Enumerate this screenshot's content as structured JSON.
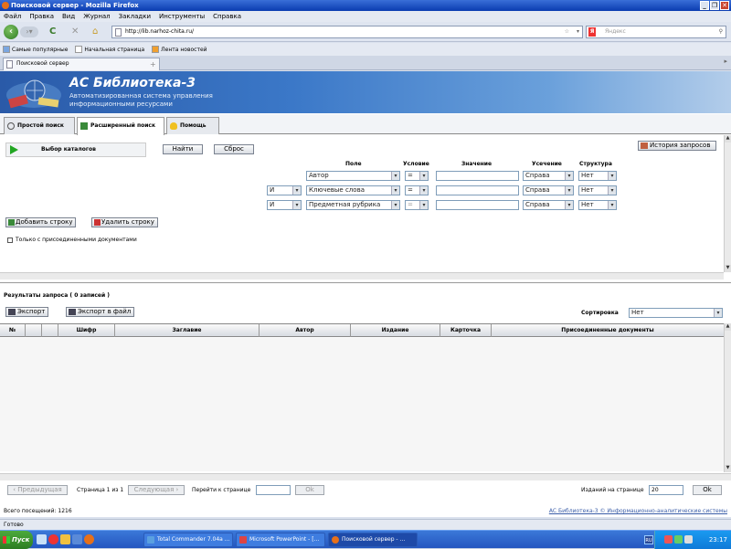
{
  "window": {
    "title": "Поисковой сервер - Mozilla Firefox",
    "controls": [
      "_",
      "❐",
      "✕"
    ]
  },
  "menu": [
    "Файл",
    "Правка",
    "Вид",
    "Журнал",
    "Закладки",
    "Инструменты",
    "Справка"
  ],
  "nav": {
    "url": "http://lib.narhoz-chita.ru/",
    "search_placeholder": "Яндекс",
    "search_engine_letter": "Я"
  },
  "bookmarks": [
    "Самые популярные",
    "Начальная страница",
    "Лента новостей"
  ],
  "browser_tab": {
    "label": "Поисковой сервер"
  },
  "banner": {
    "title": "АС Библиотека-3",
    "subtitle_line1": "Автоматизированная система управления",
    "subtitle_line2": "информационными ресурсами"
  },
  "search_tabs": [
    {
      "label": "Простой поиск"
    },
    {
      "label": "Расширенный поиск"
    },
    {
      "label": "Помощь"
    }
  ],
  "search_form": {
    "catalog_label": "Выбор каталогов",
    "find_button": "Найти",
    "reset_button": "Сброс",
    "history_button": "История запросов",
    "columns": {
      "field": "Поле",
      "condition": "Условие",
      "value": "Значение",
      "truncation": "Усечение",
      "structure": "Структура"
    },
    "rows": [
      {
        "logic": "",
        "field": "Автор",
        "condition": "=",
        "truncation": "Справа",
        "structure": "Нет"
      },
      {
        "logic": "И",
        "field": "Ключевые слова",
        "condition": "=",
        "truncation": "Справа",
        "structure": "Нет"
      },
      {
        "logic": "И",
        "field": "Предметная рубрика",
        "condition": "=",
        "truncation": "Справа",
        "structure": "Нет"
      }
    ],
    "add_row_button": "Добавить строку",
    "delete_row_button": "Удалить строку",
    "attached_checkbox_label": "Только с присоединенными документами"
  },
  "results": {
    "title": "Результаты запроса ( 0 записей )",
    "export_button": "Экспорт",
    "export_file_button": "Экспорт в файл",
    "sort_label": "Сортировка",
    "sort_value": "Нет",
    "columns": [
      "№",
      "",
      "",
      "Шифр",
      "Заглавие",
      "Автор",
      "Издание",
      "Карточка",
      "Присоединенные документы"
    ]
  },
  "pager": {
    "prev": "‹ Предыдущая",
    "page_info": "Страница 1 из 1",
    "next": "Следующая ›",
    "goto_label": "Перейти к странице",
    "goto_button": "Ok",
    "per_page_label": "Изданий на странице",
    "per_page_value": "20",
    "per_page_button": "Ok"
  },
  "footer": {
    "visits": "Всего посещений: 1216",
    "copyright": "АС Библиотека-3 © Информационно-аналитические системы"
  },
  "status": "Готово",
  "taskbar": {
    "start": "Пуск",
    "items": [
      {
        "label": "Total Commander 7.04a ..."
      },
      {
        "label": "Microsoft PowerPoint - [..."
      },
      {
        "label": "Поисковой сервер - ..."
      }
    ],
    "lang": "RU",
    "clock": "23:17"
  },
  "colors": {
    "titlebar": "#0a3cb0",
    "banner": "#3b78c8",
    "taskbar": "#2456c0",
    "start": "#2c7d22"
  }
}
